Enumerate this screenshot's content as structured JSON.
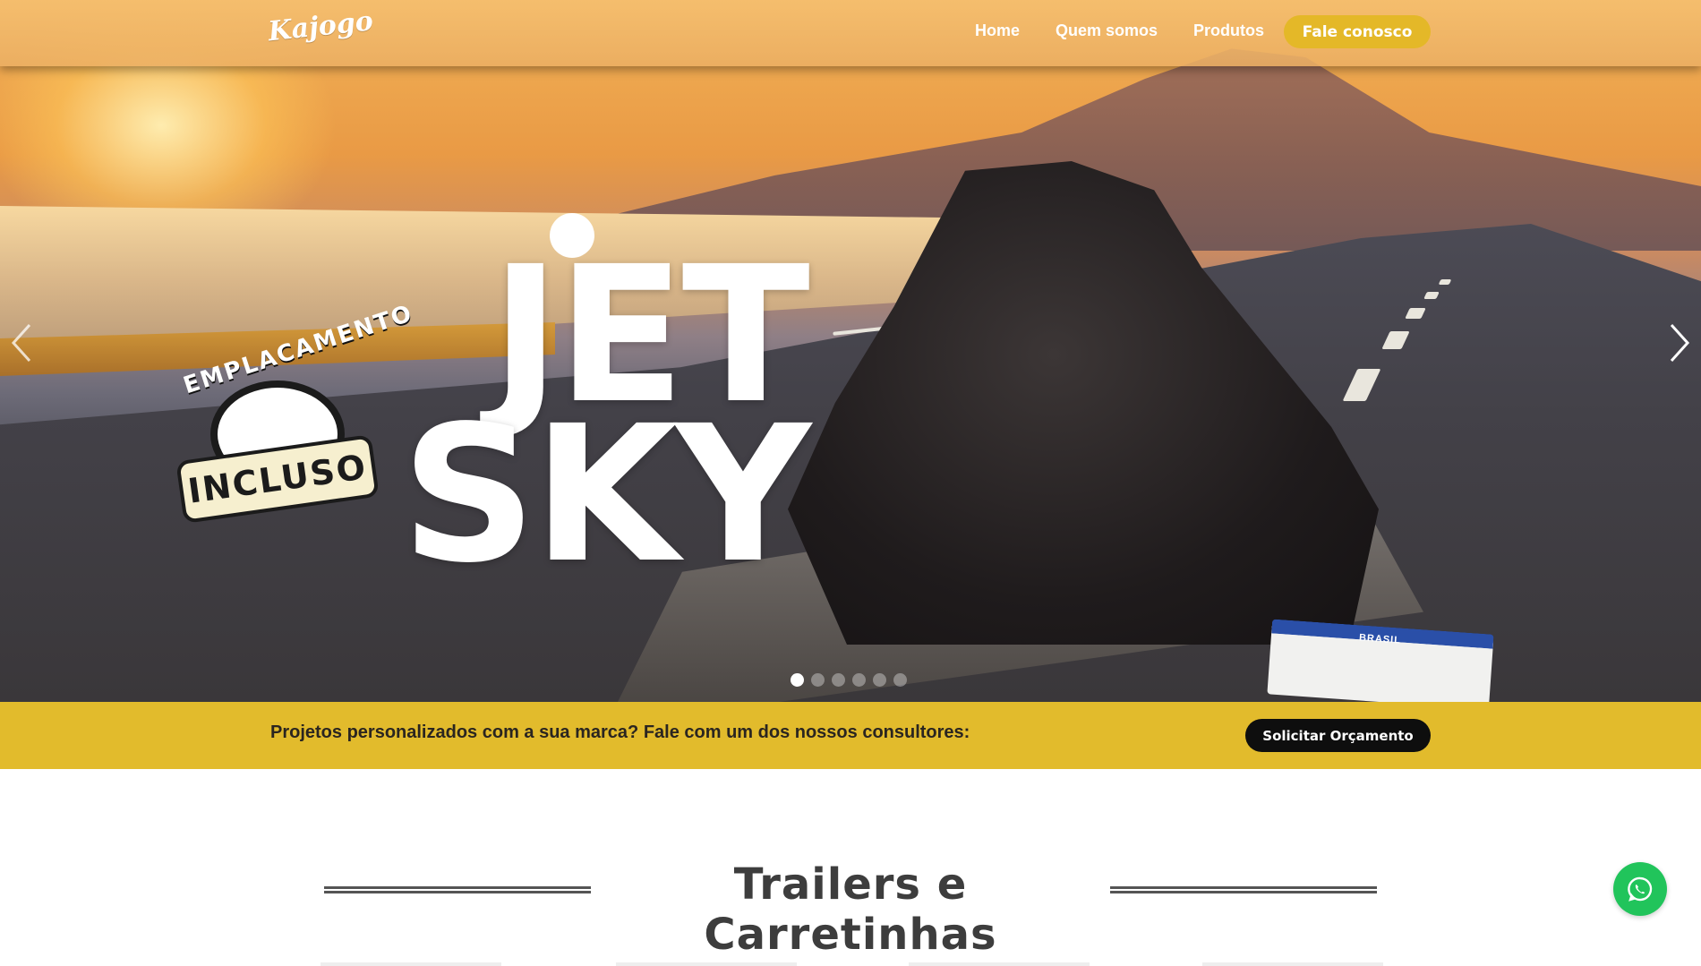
{
  "header": {
    "logo_text": "Kajogo",
    "nav": [
      {
        "label": "Home"
      },
      {
        "label": "Quem somos"
      },
      {
        "label": "Produtos"
      }
    ],
    "cta_label": "Fale conosco"
  },
  "hero": {
    "headline_line1": "JET",
    "headline_line2": "SKY",
    "badge_arc_text": "EMPLACAMENTO",
    "badge_tag_text": "INCLUSO",
    "plate_text": "BRASIL",
    "slide_count": 6,
    "active_slide": 1,
    "prev_icon": "chevron-left-icon",
    "next_icon": "chevron-right-icon"
  },
  "strip": {
    "text": "Projetos personalizados com a sua marca? Fale com um dos nossos consultores:",
    "button_label": "Solicitar Orçamento"
  },
  "section": {
    "title": "Trailers e Carretinhas"
  },
  "floating": {
    "icon": "whatsapp-icon",
    "color": "#21c45b"
  },
  "colors": {
    "accent_yellow": "#e2bb2c",
    "nav_button": "#e4b828",
    "dark_button": "#0e0e0e"
  }
}
